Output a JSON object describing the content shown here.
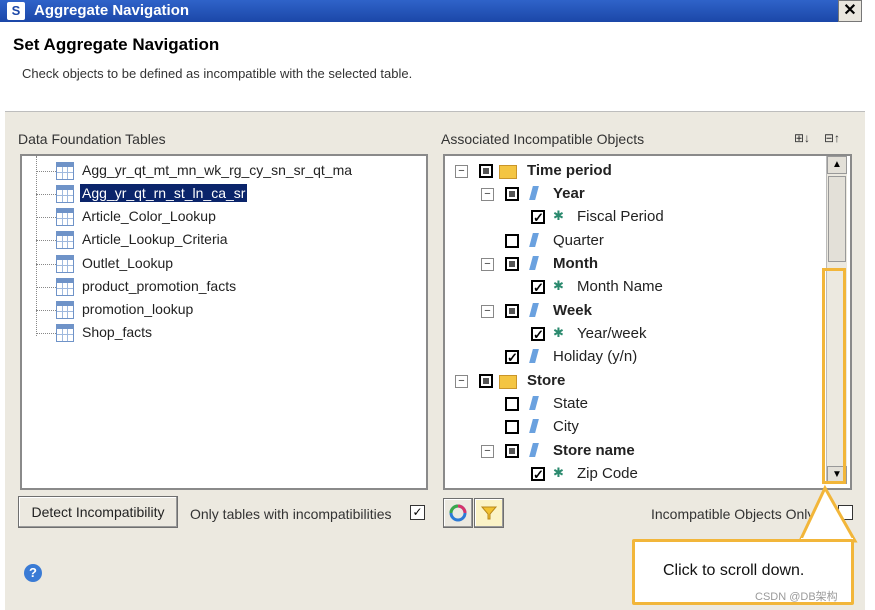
{
  "window": {
    "title": "Aggregate Navigation",
    "close_glyph": "✕"
  },
  "header": {
    "title": "Set Aggregate Navigation",
    "subtitle": "Check objects to be defined as incompatible with the selected table."
  },
  "left_panel": {
    "label": "Data Foundation Tables",
    "tables": [
      {
        "name": "Agg_yr_qt_mt_mn_wk_rg_cy_sn_sr_qt_ma",
        "selected": false
      },
      {
        "name": "Agg_yr_qt_rn_st_ln_ca_sr",
        "selected": true
      },
      {
        "name": "Article_Color_Lookup",
        "selected": false
      },
      {
        "name": "Article_Lookup_Criteria",
        "selected": false
      },
      {
        "name": "Outlet_Lookup",
        "selected": false
      },
      {
        "name": "product_promotion_facts",
        "selected": false
      },
      {
        "name": "promotion_lookup",
        "selected": false
      },
      {
        "name": "Shop_facts",
        "selected": false
      }
    ]
  },
  "right_panel": {
    "label": "Associated Incompatible Objects",
    "expand_icon": "expand-all-icon",
    "collapse_icon": "collapse-all-icon",
    "tree": [
      {
        "label": "Time period",
        "bold": true
      },
      {
        "label": "Year",
        "bold": true
      },
      {
        "label": "Fiscal Period",
        "bold": false
      },
      {
        "label": "Quarter",
        "bold": false
      },
      {
        "label": "Month",
        "bold": true
      },
      {
        "label": "Month Name",
        "bold": false
      },
      {
        "label": "Week",
        "bold": true
      },
      {
        "label": "Year/week",
        "bold": false
      },
      {
        "label": "Holiday (y/n)",
        "bold": false
      },
      {
        "label": "Store",
        "bold": true
      },
      {
        "label": "State",
        "bold": false
      },
      {
        "label": "City",
        "bold": false
      },
      {
        "label": "Store name",
        "bold": true
      },
      {
        "label": "Zip Code",
        "bold": false
      }
    ]
  },
  "bottom": {
    "detect_button": "Detect Incompatibility",
    "only_tables_label": "Only tables with incompatibilities",
    "only_tables_checked": "✓",
    "incompatible_only_label": "Incompatible Objects Only",
    "refresh_icon": "refresh-icon",
    "filter_icon": "filter-icon",
    "help_glyph": "?"
  },
  "callout": {
    "text": "Click to scroll down.",
    "border_color": "#f2b63a"
  },
  "watermark": "CSDN @DB架构",
  "colors": {
    "titlebar": "#1b47a8",
    "selection": "#0a246a",
    "highlight": "#f2b63a",
    "dialog_bg": "#ece9e0"
  }
}
